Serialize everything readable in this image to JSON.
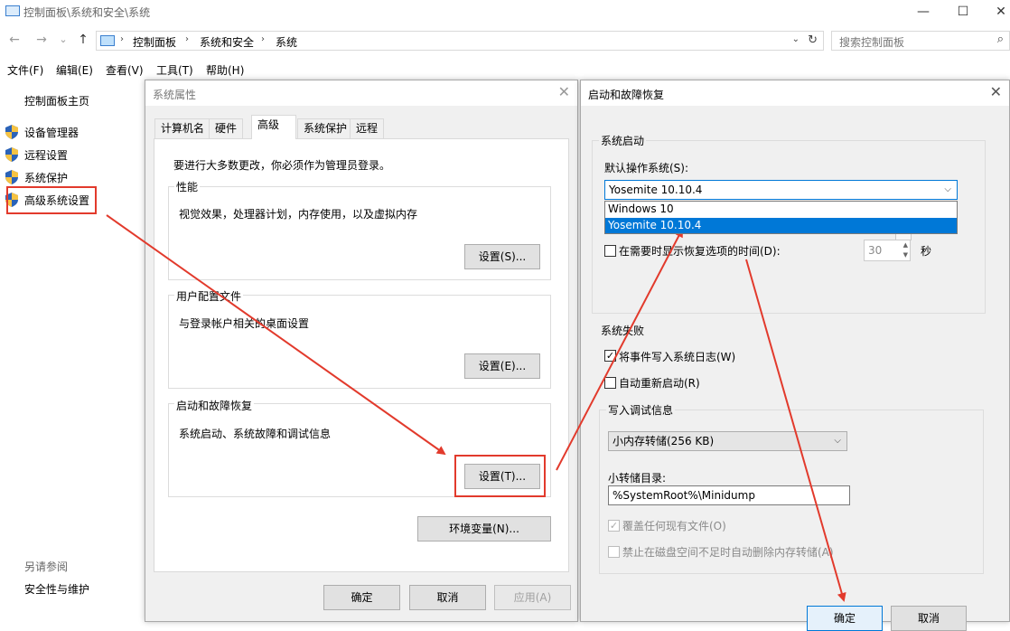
{
  "window": {
    "title": "控制面板\\系统和安全\\系统",
    "minimize": "—",
    "maximize": "☐",
    "close": "✕"
  },
  "address": {
    "back": "←",
    "forward": "→",
    "recent": "⌄",
    "up": "↑",
    "crumbs": [
      "控制面板",
      "系统和安全",
      "系统"
    ],
    "separator": "›",
    "dropdown": "⌄",
    "refresh": "↻",
    "search_placeholder": "搜索控制面板",
    "search_icon": "⌕"
  },
  "menu": [
    "文件(F)",
    "编辑(E)",
    "查看(V)",
    "工具(T)",
    "帮助(H)"
  ],
  "left_nav": {
    "home": "控制面板主页",
    "items": [
      "设备管理器",
      "远程设置",
      "系统保护",
      "高级系统设置"
    ],
    "see_also_title": "另请参阅",
    "see_also": [
      "安全性与维护"
    ]
  },
  "sysprops": {
    "title": "系统属性",
    "close": "✕",
    "tabs": [
      "计算机名",
      "硬件",
      "高级",
      "系统保护",
      "远程"
    ],
    "active_tab": "高级",
    "admin_note": "要进行大多数更改，你必须作为管理员登录。",
    "performance": {
      "label": "性能",
      "desc": "视觉效果，处理器计划，内存使用，以及虚拟内存",
      "button": "设置(S)..."
    },
    "profiles": {
      "label": "用户配置文件",
      "desc": "与登录帐户相关的桌面设置",
      "button": "设置(E)..."
    },
    "startup": {
      "label": "启动和故障恢复",
      "desc": "系统启动、系统故障和调试信息",
      "button": "设置(T)..."
    },
    "env_button": "环境变量(N)...",
    "ok": "确定",
    "cancel": "取消",
    "apply": "应用(A)"
  },
  "startup_dialog": {
    "title": "启动和故障恢复",
    "close": "✕",
    "system_startup_label": "系统启动",
    "default_os_label": "默认操作系统(S):",
    "default_os_value": "Yosemite 10.10.4",
    "os_options": [
      "Windows 10",
      "Yosemite 10.10.4"
    ],
    "selected_option": "Yosemite 10.10.4",
    "show_recovery_label": "在需要时显示恢复选项的时间(D):",
    "recovery_seconds": "30",
    "seconds_unit": "秒",
    "system_failure_label": "系统失败",
    "write_event_log": "将事件写入系统日志(W)",
    "write_event_log_checked": true,
    "auto_restart": "自动重新启动(R)",
    "auto_restart_checked": false,
    "debug_info_label": "写入调试信息",
    "debug_type": "小内存转储(256 KB)",
    "dump_dir_label": "小转储目录:",
    "dump_dir_value": "%SystemRoot%\\Minidump",
    "overwrite": "覆盖任何现有文件(O)",
    "disable_autodelete": "禁止在磁盘空间不足时自动删除内存转储(A)",
    "ok": "确定",
    "cancel": "取消"
  },
  "colors": {
    "annotation_red": "#e23a2c",
    "selection_blue": "#0078d7",
    "dialog_bg": "#f0f0f0"
  }
}
